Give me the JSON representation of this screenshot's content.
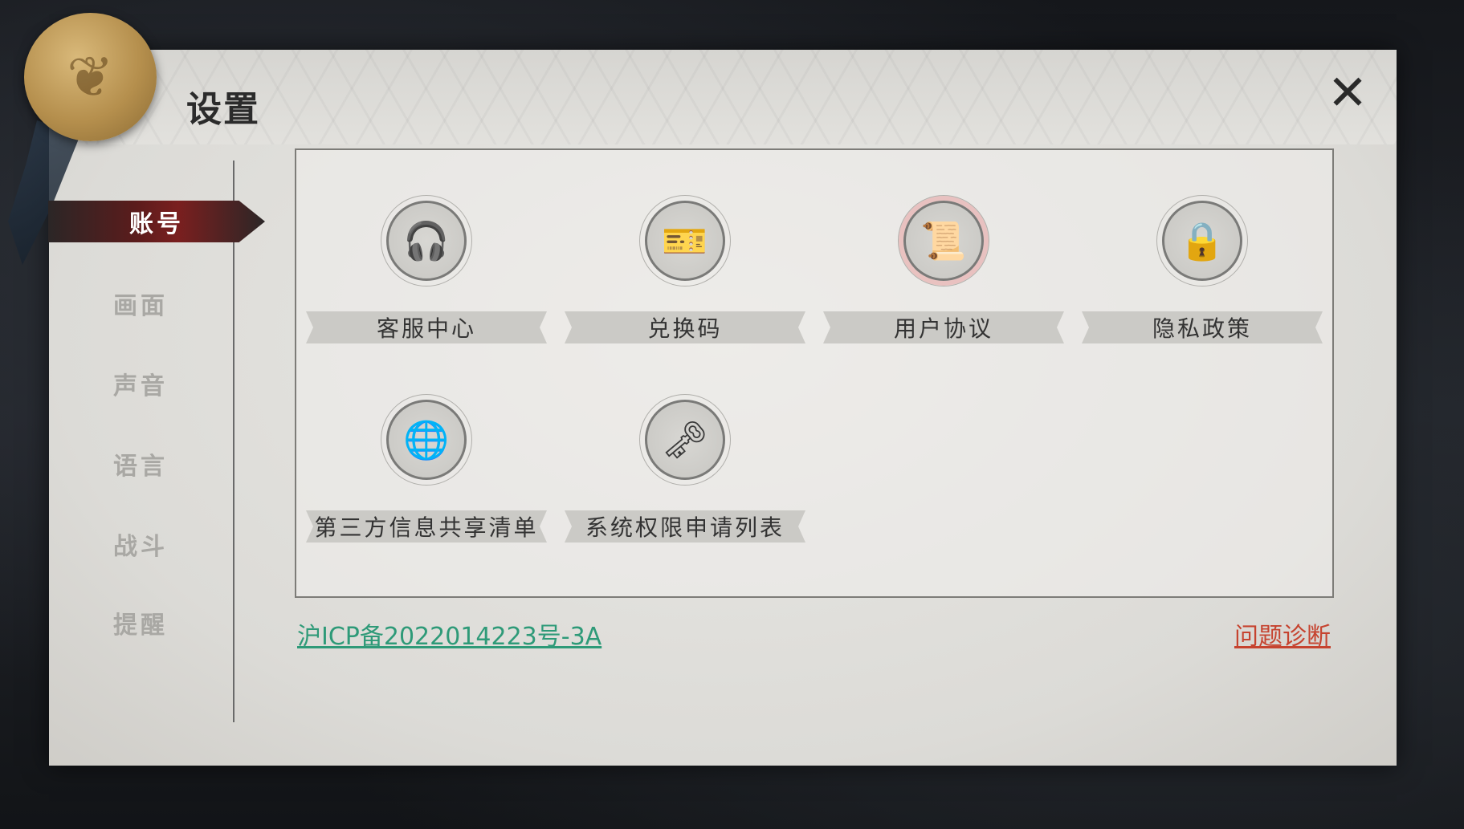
{
  "window": {
    "title": "设置",
    "close_icon": "close-icon"
  },
  "sidebar": {
    "items": [
      {
        "label": "账号",
        "active": true
      },
      {
        "label": "画面",
        "active": false
      },
      {
        "label": "声音",
        "active": false
      },
      {
        "label": "语言",
        "active": false
      },
      {
        "label": "战斗",
        "active": false
      },
      {
        "label": "提醒",
        "active": false
      }
    ]
  },
  "tiles": [
    {
      "label": "客服中心",
      "icon": "headset-icon"
    },
    {
      "label": "兑换码",
      "icon": "ticket-icon"
    },
    {
      "label": "用户协议",
      "icon": "certificate-icon"
    },
    {
      "label": "隐私政策",
      "icon": "phone-lock-icon"
    },
    {
      "label": "第三方信息共享清单",
      "icon": "globe-icon"
    },
    {
      "label": "系统权限申请列表",
      "icon": "key-icon"
    }
  ],
  "footer": {
    "icp": "沪ICP备2022014223号-3A",
    "diagnose": "问题诊断"
  },
  "colors": {
    "active_tab": "#7a1f1f",
    "icp_link": "#2e9a78",
    "diagnose_link": "#c6432f"
  }
}
